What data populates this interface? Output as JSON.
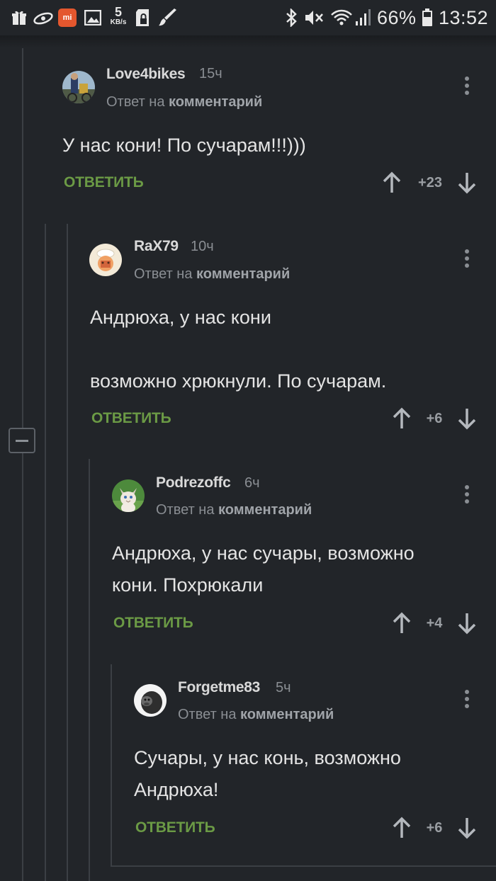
{
  "status_bar": {
    "speed_value": "5",
    "speed_unit": "KB/s",
    "battery": "66%",
    "time": "13:52",
    "icons": [
      "gift-icon",
      "cloud-icon",
      "mi-icon",
      "image-icon",
      "sd-lock-icon",
      "brush-icon",
      "bluetooth-icon",
      "mute-icon",
      "wifi-icon",
      "signal-icon",
      "battery-icon"
    ]
  },
  "reply_prefix": "Ответ на",
  "reply_target": "комментарий",
  "reply_label": "ОТВЕТИТЬ",
  "comments": [
    {
      "author": "Love4bikes",
      "time": "15ч",
      "lines": [
        "У нас кони! По сучарам!!!)))"
      ],
      "score": "+23"
    },
    {
      "author": "RaX79",
      "time": "10ч",
      "lines": [
        "Андрюха, у нас кони",
        "",
        "возможно хрюкнули. По сучарам."
      ],
      "score": "+6"
    },
    {
      "author": "Podrezoffc",
      "time": "6ч",
      "lines": [
        "Андрюха, у нас сучары, возможно",
        "кони. Похрюкали"
      ],
      "score": "+4"
    },
    {
      "author": "Forgetme83",
      "time": "5ч",
      "lines": [
        "Сучары, у нас конь, возможно",
        "Андрюха!"
      ],
      "score": "+6"
    }
  ],
  "colors": {
    "background": "#222529",
    "reply_button": "#6b9a45",
    "rail": "#3b3f44",
    "muted_text": "#8a8e93"
  }
}
